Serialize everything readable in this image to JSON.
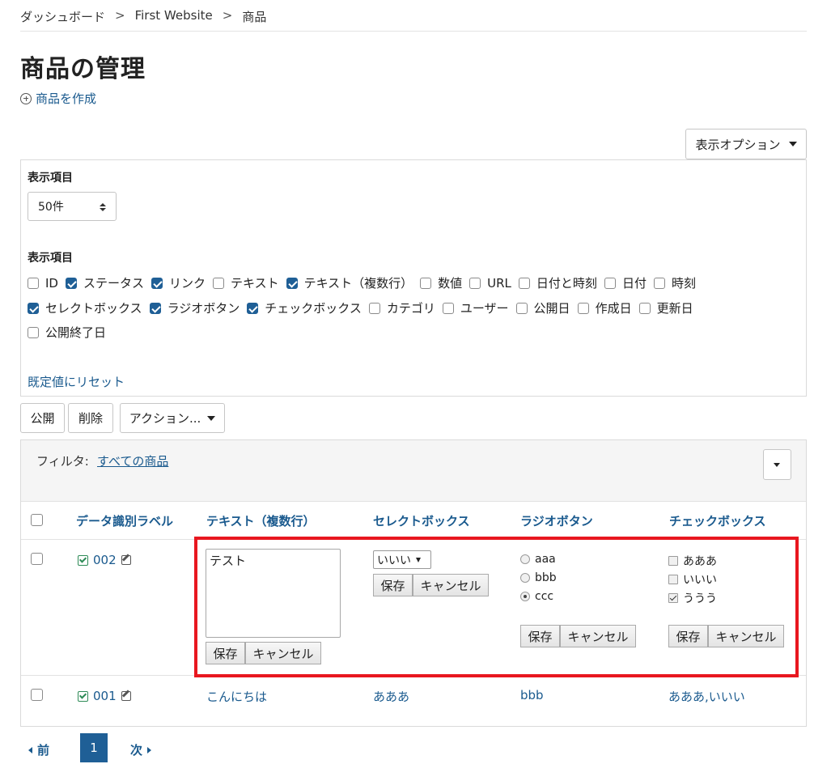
{
  "breadcrumb": [
    "ダッシュボード",
    "First Website",
    "商品"
  ],
  "breadcrumb_separator": ">",
  "page_title": "商品の管理",
  "create_link": "商品を作成",
  "display_options_button": "表示オプション",
  "options_panel": {
    "perpage_heading": "表示項目",
    "perpage_value": "50件",
    "columns_heading": "表示項目",
    "columns": [
      {
        "label": "ID",
        "checked": false
      },
      {
        "label": "ステータス",
        "checked": true
      },
      {
        "label": "リンク",
        "checked": true
      },
      {
        "label": "テキスト",
        "checked": false
      },
      {
        "label": "テキスト（複数行）",
        "checked": true
      },
      {
        "label": "数値",
        "checked": false
      },
      {
        "label": "URL",
        "checked": false
      },
      {
        "label": "日付と時刻",
        "checked": false
      },
      {
        "label": "日付",
        "checked": false
      },
      {
        "label": "時刻",
        "checked": false
      },
      {
        "label": "セレクトボックス",
        "checked": true
      },
      {
        "label": "ラジオボタン",
        "checked": true
      },
      {
        "label": "チェックボックス",
        "checked": true
      },
      {
        "label": "カテゴリ",
        "checked": false
      },
      {
        "label": "ユーザー",
        "checked": false
      },
      {
        "label": "公開日",
        "checked": false
      },
      {
        "label": "作成日",
        "checked": false
      },
      {
        "label": "更新日",
        "checked": false
      },
      {
        "label": "公開終了日",
        "checked": false
      }
    ],
    "reset_link": "既定値にリセット"
  },
  "actions": {
    "publish": "公開",
    "delete": "削除",
    "action_menu": "アクション..."
  },
  "filter": {
    "label": "フィルタ:",
    "value": "すべての商品"
  },
  "table": {
    "headers": [
      "データ識別ラベル",
      "テキスト（複数行）",
      "セレクトボックス",
      "ラジオボタン",
      "チェックボックス"
    ],
    "editing_row": {
      "label": "002",
      "textarea_value": "テスト",
      "select_value": "いいい",
      "radio_options": [
        {
          "label": "aaa",
          "selected": false
        },
        {
          "label": "bbb",
          "selected": false
        },
        {
          "label": "ccc",
          "selected": true
        }
      ],
      "checkbox_options": [
        {
          "label": "あああ",
          "checked": false
        },
        {
          "label": "いいい",
          "checked": false
        },
        {
          "label": "ううう",
          "checked": true
        }
      ],
      "save": "保存",
      "cancel": "キャンセル"
    },
    "rows": [
      {
        "label": "001",
        "text": "こんにちは",
        "select": "あああ",
        "radio": "bbb",
        "checkbox": "あああ,いいい"
      }
    ]
  },
  "pagination": {
    "prev": "前",
    "current": "1",
    "next": "次"
  },
  "colors": {
    "link": "#1a5a8e",
    "primary": "#1f5f96",
    "highlight": "#e8171f"
  }
}
